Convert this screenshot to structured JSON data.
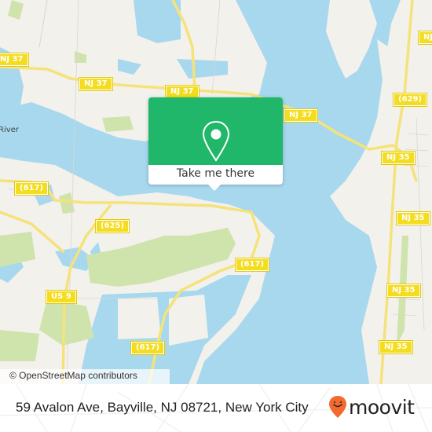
{
  "map": {
    "colors": {
      "water": "#a8d8ee",
      "land": "#f2f1ec",
      "park": "#cfe3ac",
      "road": "#f6e27a",
      "shield": "#f4dc1e"
    },
    "road_shields": [
      {
        "id": "nj37-west",
        "label": "NJ 37"
      },
      {
        "id": "nj37-mid",
        "label": "NJ 37"
      },
      {
        "id": "nj37-east",
        "label": "NJ 37"
      },
      {
        "id": "nj-ne",
        "label": "NJ"
      },
      {
        "id": "r629",
        "label": "(629)"
      },
      {
        "id": "nj35-a",
        "label": "NJ 35"
      },
      {
        "id": "r617-w",
        "label": "(617)"
      },
      {
        "id": "r625",
        "label": "(625)"
      },
      {
        "id": "nj35-b",
        "label": "NJ 35"
      },
      {
        "id": "r617-e",
        "label": "(617)"
      },
      {
        "id": "us9",
        "label": "US 9"
      },
      {
        "id": "nj35-c",
        "label": "NJ 35"
      },
      {
        "id": "r617-s",
        "label": "(617)"
      },
      {
        "id": "nj35-d",
        "label": "NJ 35"
      }
    ],
    "place_labels": [
      {
        "label": "River"
      }
    ],
    "attribution": "© OpenStreetMap contributors"
  },
  "popup": {
    "icon": "map-pin-icon",
    "button_label": "Take me there",
    "color": "#21b76b"
  },
  "footer": {
    "address": "59 Avalon Ave, Bayville, NJ 08721, New York City",
    "brand": "moovit",
    "brand_color": "#f26a2e"
  }
}
